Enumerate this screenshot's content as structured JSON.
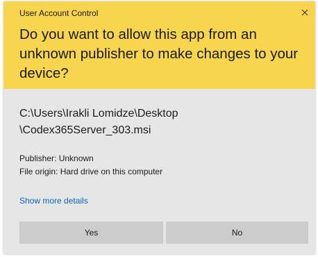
{
  "dialog": {
    "title": "User Account Control",
    "close_icon": "close-icon",
    "question": "Do you want to allow this app from an unknown publisher to make changes to your device?",
    "path_line1": "C:\\Users\\Irakli Lomidze\\Desktop",
    "path_line2": "\\Codex365Server_303.msi",
    "publisher": "Publisher: Unknown",
    "file_origin": "File origin: Hard drive on this computer",
    "details_link": "Show more details",
    "yes_label": "Yes",
    "no_label": "No"
  },
  "colors": {
    "header_bg": "#f8d54f",
    "body_bg": "#e6e6e6",
    "button_bg": "#cccccc",
    "link": "#0a64b8"
  }
}
